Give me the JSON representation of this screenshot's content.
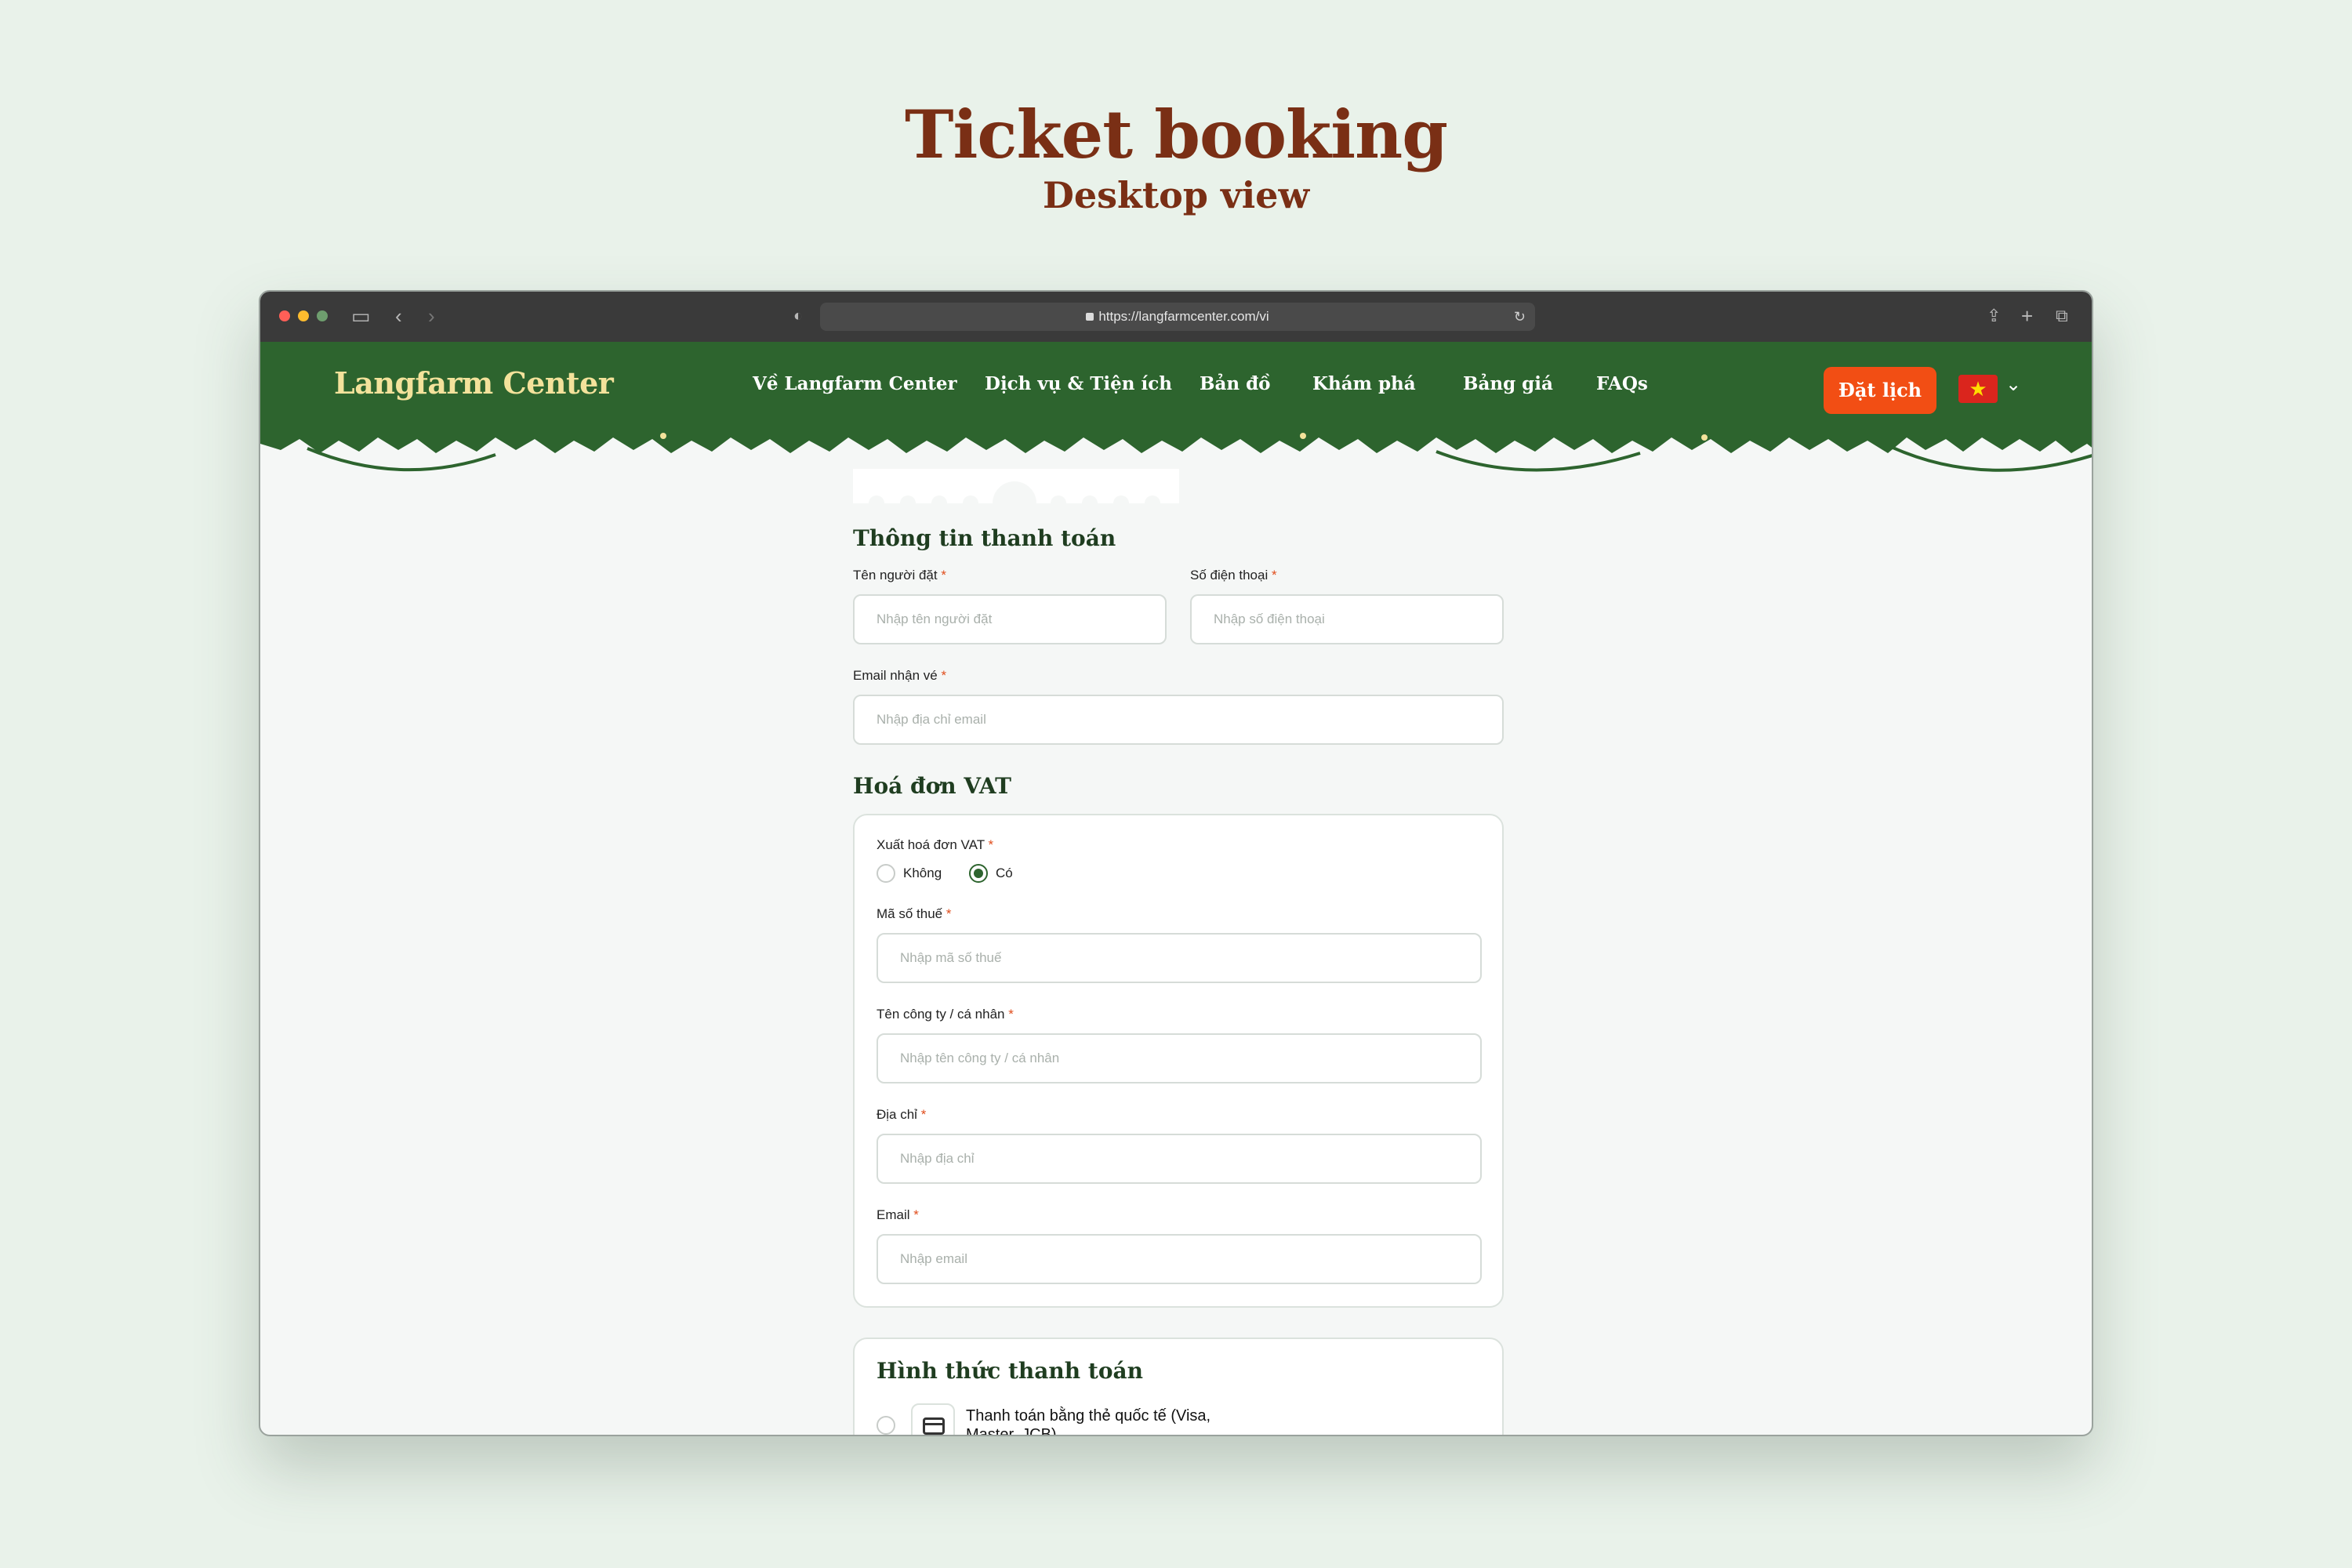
{
  "page": {
    "title": "Ticket booking",
    "subtitle": "Desktop view"
  },
  "browser": {
    "url": "https://langfarmcenter.com/vi"
  },
  "navbar": {
    "logo": "Langfarm Center",
    "links": [
      "Về Langfarm Center",
      "Dịch vụ & Tiện ích",
      "Bản đồ",
      "Khám phá",
      "Bảng giá",
      "FAQs"
    ],
    "book_button": "Đặt lịch",
    "language": "vi",
    "brand_color": "#2d642e",
    "accent_color": "#f24e14"
  },
  "payment_info": {
    "title": "Thông tin thanh toán",
    "name_label": "Tên người đặt",
    "name_placeholder": "Nhập tên người đặt",
    "phone_label": "Số điện thoại",
    "phone_placeholder": "Nhập số điện thoại",
    "email_label": "Email nhận vé",
    "email_placeholder": "Nhập địa chỉ email",
    "required_mark": "*"
  },
  "vat": {
    "title": "Hoá đơn VAT",
    "issue_label": "Xuất hoá đơn VAT",
    "option_no": "Không",
    "option_yes": "Có",
    "selected": "Có",
    "tax_label": "Mã số thuế",
    "tax_placeholder": "Nhập mã số thuế",
    "company_label": "Tên công ty / cá nhân",
    "company_placeholder": "Nhập tên công ty / cá nhân",
    "address_label": "Địa chỉ",
    "address_placeholder": "Nhập địa chỉ",
    "email_label": "Email",
    "email_placeholder": "Nhập email"
  },
  "payment_method": {
    "title": "Hình thức thanh toán",
    "options": [
      {
        "label": "Thanh toán bằng thẻ quốc tế (Visa, Master, JCB)",
        "icon": "credit-card-icon"
      }
    ]
  }
}
